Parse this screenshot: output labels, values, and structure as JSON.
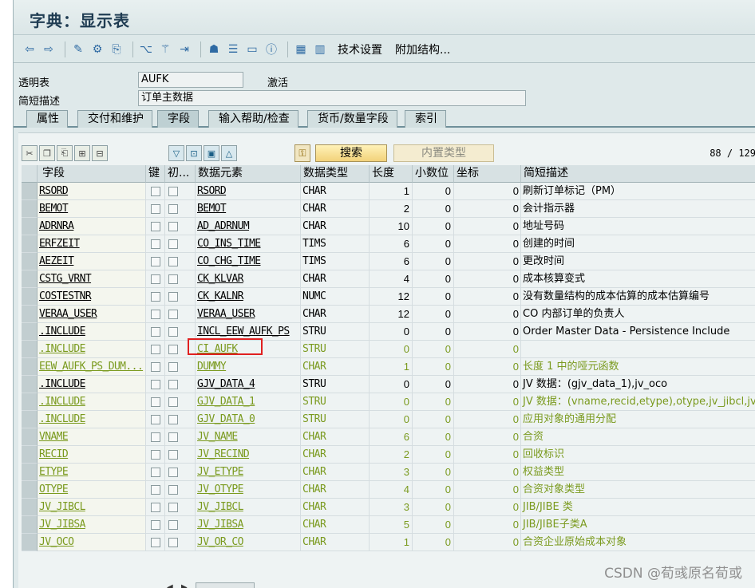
{
  "window": {
    "title": "字典：显示表"
  },
  "toolbar": {
    "tech_settings": "技术设置",
    "append_structure": "附加结构..."
  },
  "form": {
    "table_label": "透明表",
    "table_value": "AUFK",
    "status": "激活",
    "desc_label": "简短描述",
    "desc_value": "订单主数据"
  },
  "tabs": [
    "属性",
    "交付和维护",
    "字段",
    "输入帮助/检查",
    "货币/数量字段",
    "索引"
  ],
  "active_tab": "字段",
  "panel": {
    "search_label": "搜索",
    "builtin_label": "内置类型",
    "pager": "88 / 129"
  },
  "columns": [
    "字段",
    "键",
    "初...",
    "数据元素",
    "数据类型",
    "长度",
    "小数位",
    "坐标",
    "简短描述"
  ],
  "rows": [
    {
      "field": "RSORD",
      "elem": "RSORD",
      "type": "CHAR",
      "len": "1",
      "dec": "0",
      "coord": "0",
      "desc": "刷新订单标记（PM）",
      "green": false
    },
    {
      "field": "BEMOT",
      "elem": "BEMOT",
      "type": "CHAR",
      "len": "2",
      "dec": "0",
      "coord": "0",
      "desc": "会计指示器",
      "green": false
    },
    {
      "field": "ADRNRA",
      "elem": "AD_ADRNUM",
      "type": "CHAR",
      "len": "10",
      "dec": "0",
      "coord": "0",
      "desc": "地址号码",
      "green": false
    },
    {
      "field": "ERFZEIT",
      "elem": "CO_INS_TIME",
      "type": "TIMS",
      "len": "6",
      "dec": "0",
      "coord": "0",
      "desc": "创建的时间",
      "green": false
    },
    {
      "field": "AEZEIT",
      "elem": "CO_CHG_TIME",
      "type": "TIMS",
      "len": "6",
      "dec": "0",
      "coord": "0",
      "desc": "更改时间",
      "green": false
    },
    {
      "field": "CSTG_VRNT",
      "elem": "CK_KLVAR",
      "type": "CHAR",
      "len": "4",
      "dec": "0",
      "coord": "0",
      "desc": "成本核算变式",
      "green": false
    },
    {
      "field": "COSTESTNR",
      "elem": "CK_KALNR",
      "type": "NUMC",
      "len": "12",
      "dec": "0",
      "coord": "0",
      "desc": "没有数量结构的成本估算的成本估算编号",
      "green": false
    },
    {
      "field": "VERAA_USER",
      "elem": "VERAA_USER",
      "type": "CHAR",
      "len": "12",
      "dec": "0",
      "coord": "0",
      "desc": "CO 内部订单的负责人",
      "green": false
    },
    {
      "field": ".INCLUDE",
      "elem": "INCL_EEW_AUFK_PS",
      "type": "STRU",
      "len": "0",
      "dec": "0",
      "coord": "0",
      "desc": "Order Master Data - Persistence Include",
      "green": false
    },
    {
      "field": ".INCLUDE",
      "elem": "CI_AUFK",
      "type": "STRU",
      "len": "0",
      "dec": "0",
      "coord": "0",
      "desc": "",
      "green": true
    },
    {
      "field": "EEW_AUFK_PS_DUM...",
      "elem": "DUMMY",
      "type": "CHAR",
      "len": "1",
      "dec": "0",
      "coord": "0",
      "desc": "长度 1 中的哑元函数",
      "green": true
    },
    {
      "field": ".INCLUDE",
      "elem": "GJV_DATA_4",
      "type": "STRU",
      "len": "0",
      "dec": "0",
      "coord": "0",
      "desc": "JV 数据：(gjv_data_1),jv_oco",
      "green": false
    },
    {
      "field": ".INCLUDE",
      "elem": "GJV_DATA_1",
      "type": "STRU",
      "len": "0",
      "dec": "0",
      "coord": "0",
      "desc": "JV 数据：(vname,recid,etype),otype,jv_jibcl,jv_jibs",
      "green": true
    },
    {
      "field": ".INCLUDE",
      "elem": "GJV_DATA_0",
      "type": "STRU",
      "len": "0",
      "dec": "0",
      "coord": "0",
      "desc": "应用对象的通用分配",
      "green": true
    },
    {
      "field": "VNAME",
      "elem": "JV_NAME",
      "type": "CHAR",
      "len": "6",
      "dec": "0",
      "coord": "0",
      "desc": "合资",
      "green": true
    },
    {
      "field": "RECID",
      "elem": "JV_RECIND",
      "type": "CHAR",
      "len": "2",
      "dec": "0",
      "coord": "0",
      "desc": "回收标识",
      "green": true
    },
    {
      "field": "ETYPE",
      "elem": "JV_ETYPE",
      "type": "CHAR",
      "len": "3",
      "dec": "0",
      "coord": "0",
      "desc": "权益类型",
      "green": true
    },
    {
      "field": "OTYPE",
      "elem": "JV_OTYPE",
      "type": "CHAR",
      "len": "4",
      "dec": "0",
      "coord": "0",
      "desc": "合资对象类型",
      "green": true
    },
    {
      "field": "JV_JIBCL",
      "elem": "JV_JIBCL",
      "type": "CHAR",
      "len": "3",
      "dec": "0",
      "coord": "0",
      "desc": "JIB/JIBE 类",
      "green": true
    },
    {
      "field": "JV_JIBSA",
      "elem": "JV_JIBSA",
      "type": "CHAR",
      "len": "5",
      "dec": "0",
      "coord": "0",
      "desc": "JIB/JIBE子类A",
      "green": true
    },
    {
      "field": "JV_OCO",
      "elem": "JV_OR_CO",
      "type": "CHAR",
      "len": "1",
      "dec": "0",
      "coord": "0",
      "desc": "合资企业原始成本对象",
      "green": true
    }
  ],
  "watermark": "CSDN @荀彧原名荀或",
  "colors": {
    "green_text": "#7a9a1e",
    "highlight": "#e02020",
    "window_bg": "#dfe9ea"
  }
}
